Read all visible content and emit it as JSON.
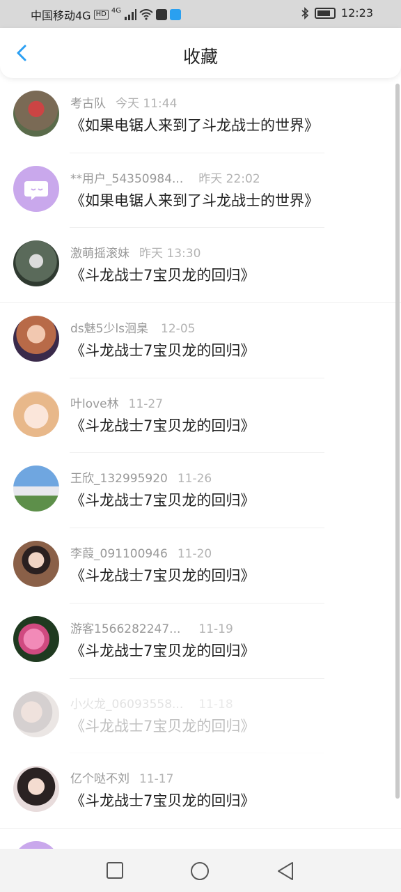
{
  "status_bar": {
    "carrier": "中国移动4G",
    "hd_badge": "HD",
    "network": "4G",
    "time": "12:23"
  },
  "header": {
    "title": "收藏"
  },
  "items": [
    {
      "user": "考古队",
      "time": "今天 11:44",
      "title": "《如果电锯人来到了斗龙战士的世界》",
      "avatar_color": "#6b5a4a"
    },
    {
      "user": "**用户_54350984...",
      "time": "昨天 22:02",
      "title": "《如果电锯人来到了斗龙战士的世界》",
      "avatar_color": "#c9a8ec"
    },
    {
      "user": "激萌摇滚妹",
      "time": "昨天 13:30",
      "title": "《斗龙战士7宝贝龙的回归》",
      "avatar_color": "#556655"
    },
    {
      "user": "ds魅5少ls洄臬",
      "time": "12-05",
      "title": "《斗龙战士7宝贝龙的回归》",
      "avatar_color": "#a56b6b"
    },
    {
      "user": "叶love林",
      "time": "11-27",
      "title": "《斗龙战士7宝贝龙的回归》",
      "avatar_color": "#f0d0b8"
    },
    {
      "user": "王欣_132995920",
      "time": "11-26",
      "title": "《斗龙战士7宝贝龙的回归》",
      "avatar_color": "#7aa7d8"
    },
    {
      "user": "李葭_091100946",
      "time": "11-20",
      "title": "《斗龙战士7宝贝龙的回归》",
      "avatar_color": "#6a5040"
    },
    {
      "user": "游客1566282247...",
      "time": "11-19",
      "title": "《斗龙战士7宝贝龙的回归》",
      "avatar_color": "#d04a80"
    },
    {
      "user": "小火龙_06093558...",
      "time": "11-18",
      "title": "《斗龙战士7宝贝龙的回归》",
      "avatar_color": "#9a8a88"
    },
    {
      "user": "亿个哒不刘",
      "time": "11-17",
      "title": "《斗龙战士7宝贝龙的回归》",
      "avatar_color": "#3b3030"
    }
  ],
  "colors": {
    "back_arrow": "#2a9ff3",
    "bubble_icon_bg": "#c9a8ec"
  }
}
